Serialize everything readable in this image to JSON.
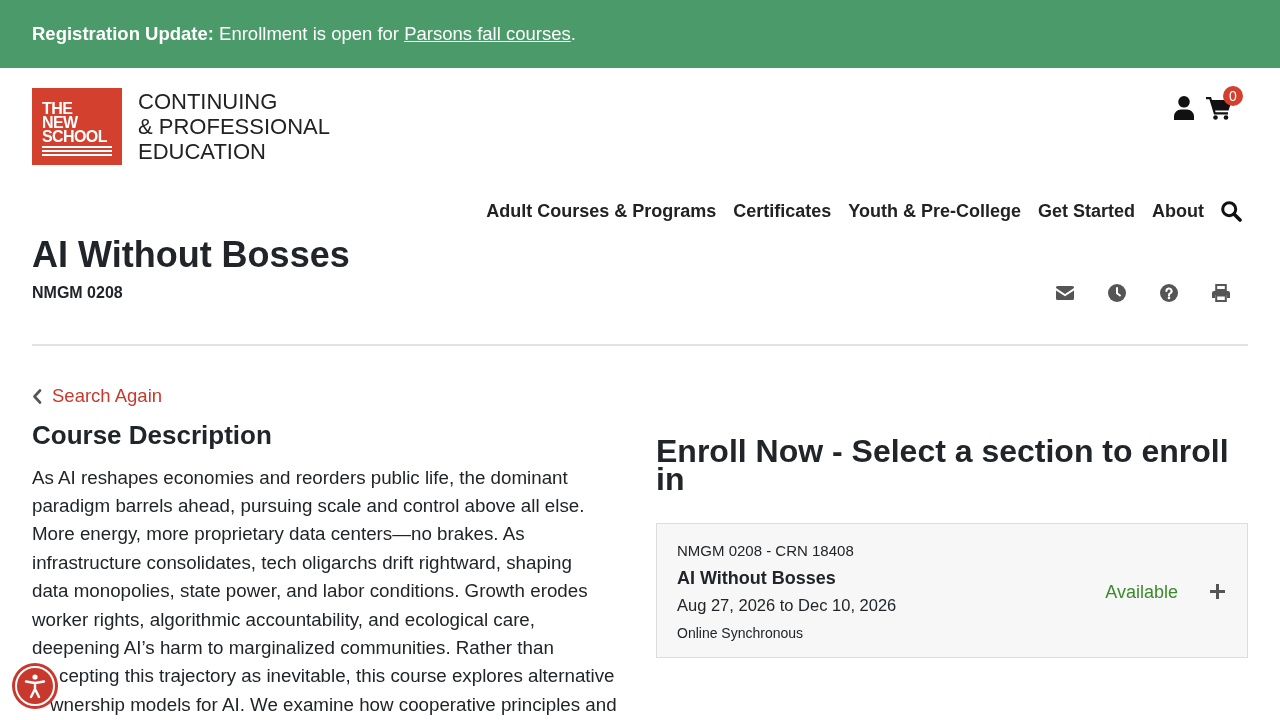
{
  "announcement": {
    "message": "**Registration Update:** Enrollment is open for",
    "link": "Parsons fall courses",
    "after_link": "."
  },
  "logo": {
    "mark_lines": [
      "THE",
      "NEW",
      "SCHOOL"
    ],
    "wordmark_lines": [
      "CONTINUING",
      "& PROFESSIONAL",
      "EDUCATION"
    ]
  },
  "cart": {
    "count": "0"
  },
  "nav": [
    {
      "label": "Adult Courses & Programs"
    },
    {
      "label": "Certificates"
    },
    {
      "label": "Youth & Pre-College"
    },
    {
      "label": "Get Started"
    },
    {
      "label": "About"
    }
  ],
  "course": {
    "title": "AI Without Bosses",
    "code": "NMGM 0208"
  },
  "back_link": {
    "label": "Search Again"
  },
  "description": {
    "heading": "Course Description",
    "text": "As AI reshapes economies and reorders public life, the dominant paradigm barrels ahead, pursuing scale and control above all else. More energy, more proprietary data centers—no brakes. As infrastructure consolidates, tech oligarchs drift rightward, shaping data monopolies, state power, and labor conditions. Growth erodes worker rights, algorithmic accountability, and ecological care, deepening AI’s harm to marginalized communities. Rather than",
    "text_beside_button": "cepting this trajectory as inevitable, this course explores alternative wnership models for AI. We examine how cooperative principles and"
  },
  "enroll": {
    "heading": "Enroll Now - Select a section to enroll in",
    "sections": [
      {
        "code": "NMGM 0208 - CRN 18408",
        "title": "AI Without Bosses",
        "dates": "Aug 27, 2026 to Dec 10, 2026",
        "format": "Online Synchronous",
        "status": "Available",
        "expanded": false
      }
    ]
  }
}
